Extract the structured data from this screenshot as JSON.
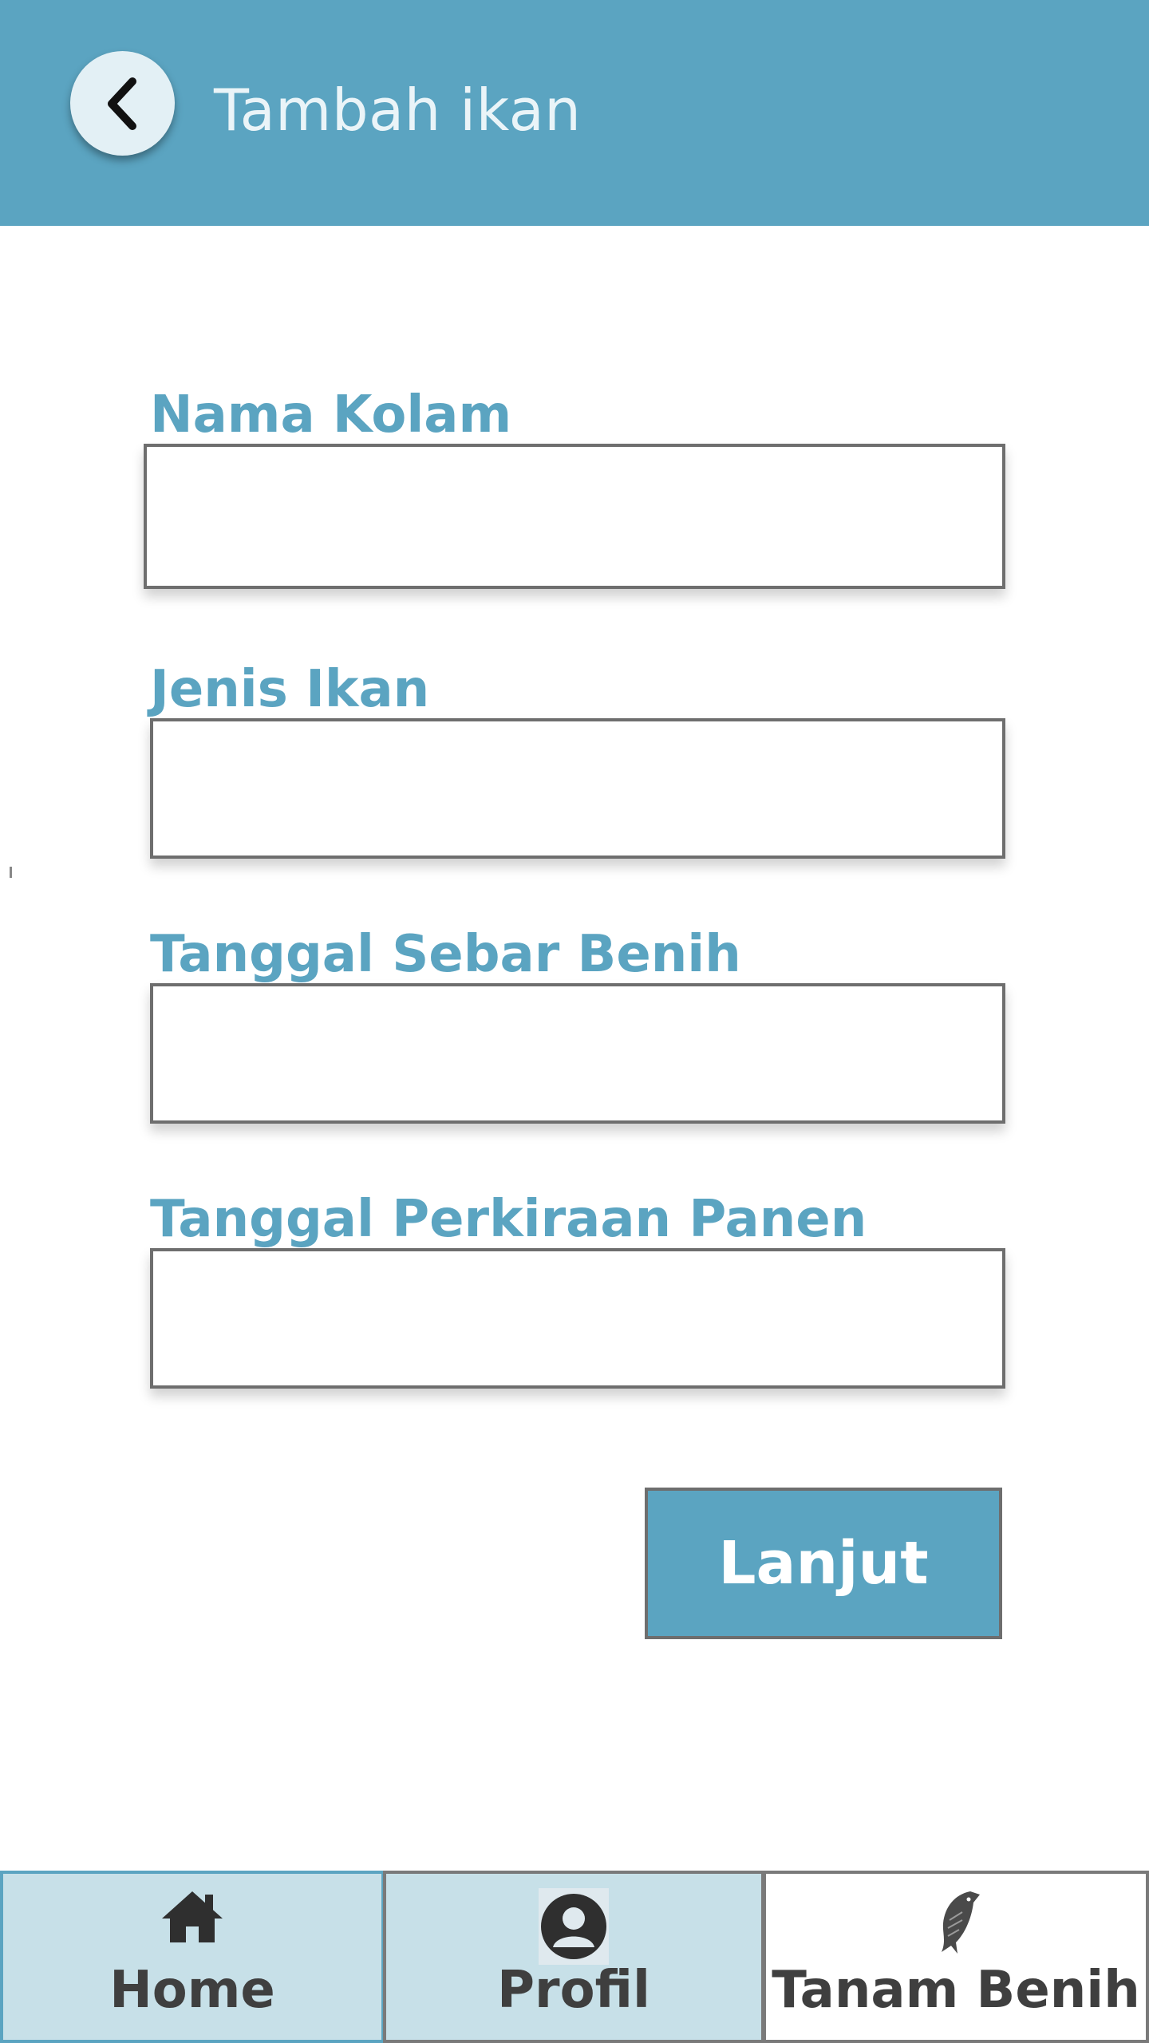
{
  "header": {
    "title": "Tambah ikan",
    "back_icon": "chevron-left-icon"
  },
  "form": {
    "fields": [
      {
        "label": "Nama Kolam",
        "value": "",
        "placeholder": ""
      },
      {
        "label": "Jenis Ikan",
        "value": "",
        "placeholder": ""
      },
      {
        "label": "Tanggal Sebar Benih",
        "value": "",
        "placeholder": ""
      },
      {
        "label": "Tanggal Perkiraan Panen",
        "value": "",
        "placeholder": ""
      }
    ],
    "submit_label": "Lanjut"
  },
  "bottom_nav": {
    "items": [
      {
        "label": "Home",
        "icon": "home-icon",
        "active": false
      },
      {
        "label": "Profil",
        "icon": "user-icon",
        "active": false
      },
      {
        "label": "Tanam Benih",
        "icon": "fish-icon",
        "active": true
      }
    ]
  },
  "colors": {
    "primary": "#5ba4c1",
    "tab_inactive": "#c7e0e8",
    "tab_active": "#ffffff",
    "border": "#6e6e6e"
  }
}
